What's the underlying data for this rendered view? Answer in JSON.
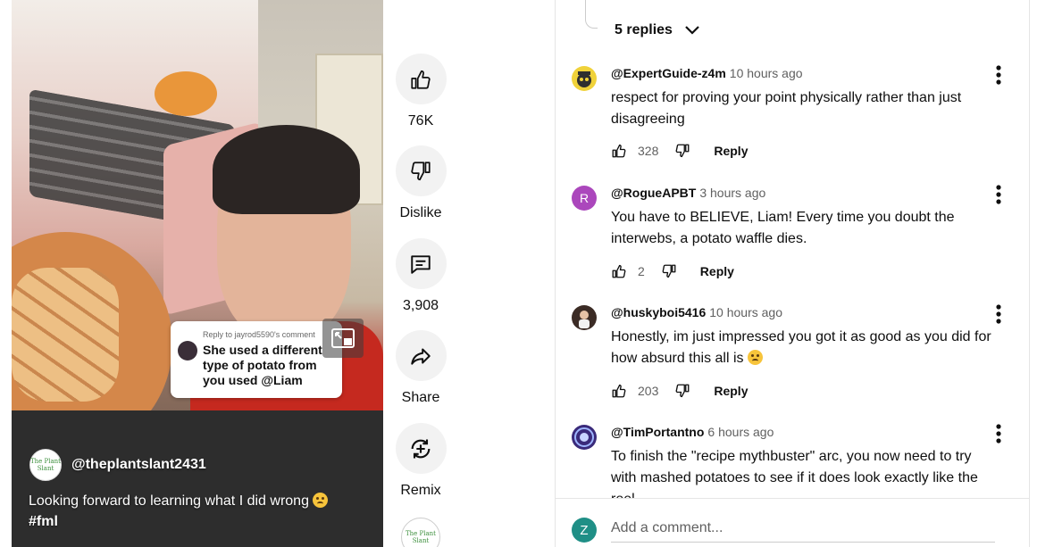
{
  "video": {
    "channel": "@theplantslant2431",
    "channel_logo_text": "The Plant Slant",
    "caption": "Looking forward to learning what I did wrong",
    "hashtag": "#fml",
    "reply_sticker": {
      "reply_to": "Reply to jayrod5590's comment",
      "text": "She used a different type of potato from you used @Liam"
    }
  },
  "actions": {
    "like_count": "76K",
    "dislike_label": "Dislike",
    "comment_count": "3,908",
    "share_label": "Share",
    "remix_label": "Remix"
  },
  "comments": {
    "replies_label": "5 replies",
    "items": [
      {
        "user": "@ExpertGuide-z4m",
        "time": "10 hours ago",
        "text": "respect for proving your point physically rather than just disagreeing",
        "likes": "328",
        "reply_label": "Reply",
        "avatar_color": "#f0d23a"
      },
      {
        "user": "@RogueAPBT",
        "time": "3 hours ago",
        "text": "You have to BELIEVE, Liam! Every time you doubt the interwebs, a potato waffle dies.",
        "likes": "2",
        "reply_label": "Reply",
        "avatar_letter": "R",
        "avatar_color": "#ab47bc"
      },
      {
        "user": "@huskyboi5416",
        "time": "10 hours ago",
        "text": "Honestly, im just impressed you got it as good as you did for how absurd this all is",
        "likes": "203",
        "reply_label": "Reply",
        "avatar_color": "#3b2b25"
      },
      {
        "user": "@TimPortantno",
        "time": "6 hours ago",
        "text": "To finish the \"recipe mythbuster\" arc, you now need to try with mashed potatoes to see if it does look exactly like the reel",
        "avatar_color": "#3a2a7a"
      }
    ],
    "add_placeholder": "Add a comment...",
    "current_user_initial": "Z"
  }
}
